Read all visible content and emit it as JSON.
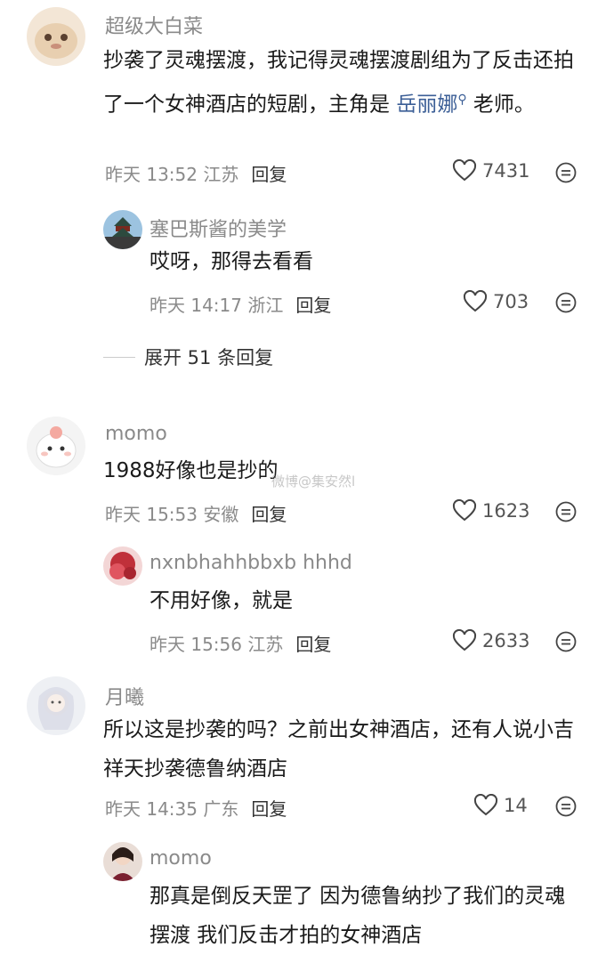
{
  "comments": [
    {
      "user": "超级大白菜",
      "text_before": "抄袭了灵魂摆渡，我记得灵魂摆渡剧组为了反击还拍了一个女神酒店的短剧，主角是 ",
      "link": "岳丽娜",
      "text_after": " 老师。",
      "time": "昨天 13:52 江苏",
      "reply_label": "回复",
      "likes": "7431",
      "replies": [
        {
          "user": "塞巴斯酱的美学",
          "text": "哎呀，那得去看看",
          "time": "昨天 14:17 浙江",
          "reply_label": "回复",
          "likes": "703"
        }
      ],
      "expand_label": "展开 51 条回复"
    },
    {
      "user": "momo",
      "text": "1988好像也是抄的",
      "time": "昨天 15:53 安徽",
      "reply_label": "回复",
      "likes": "1623",
      "replies": [
        {
          "user": "nxnbhahhbbxb hhhd",
          "text": "不用好像，就是",
          "time": "昨天 15:56 江苏",
          "reply_label": "回复",
          "likes": "2633"
        }
      ]
    },
    {
      "user": "月曦",
      "text": "所以这是抄袭的吗？之前出女神酒店，还有人说小吉祥天抄袭德鲁纳酒店",
      "time": "昨天 14:35 广东",
      "reply_label": "回复",
      "likes": "14",
      "replies": [
        {
          "user": "momo",
          "text": "那真是倒反天罡了 因为德鲁纳抄了我们的灵魂摆渡 我们反击才拍的女神酒店"
        }
      ]
    }
  ],
  "watermark": "微博@集安然l",
  "colors": {
    "link": "#3b5e96",
    "meta": "#8a8a8a"
  }
}
